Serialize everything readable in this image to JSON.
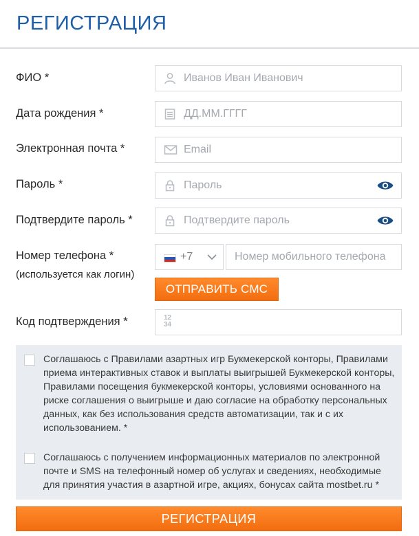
{
  "header": {
    "title": "РЕГИСТРАЦИЯ"
  },
  "form": {
    "fio": {
      "label": "ФИО *",
      "placeholder": "Иванов Иван Иванович",
      "icon": "user-icon"
    },
    "birth": {
      "label": "Дата рождения *",
      "placeholder": "ДД.ММ.ГГГГ",
      "icon": "calendar-icon"
    },
    "email": {
      "label": "Электронная почта *",
      "placeholder": "Email",
      "icon": "envelope-icon"
    },
    "password": {
      "label": "Пароль *",
      "placeholder": "Пароль",
      "icon": "lock-icon",
      "toggle_icon": "eye-icon"
    },
    "confirm": {
      "label": "Подтвердите пароль *",
      "placeholder": "Подтвердите пароль",
      "icon": "lock-icon",
      "toggle_icon": "eye-icon"
    },
    "phone": {
      "label": "Номер телефона *",
      "sublabel": "(используется как логин)",
      "country_code": "+7",
      "flag": "russia-flag-icon",
      "placeholder": "Номер мобильного телефона"
    },
    "sms_button": "ОТПРАВИТЬ СМС",
    "code": {
      "label": "Код подтверждения *",
      "icon_text_top": "12",
      "icon_text_bottom": "34"
    }
  },
  "consents": [
    {
      "checked": false,
      "text": "Соглашаюсь с Правилами азартных игр Букмекерской конторы, Правилами приема интерактивных ставок и выплаты выигрышей Букмекерской конторы, Правилами посещения букмекерской конторы, условиями основанного на риске соглашения о выигрыше и даю согласие на обработку персональных данных, как без использования средств автоматизации, так и с их использованием. *"
    },
    {
      "checked": false,
      "text": "Соглашаюсь с получением информационных материалов по электронной почте и SMS на телефонный номер об услугах и сведениях, необходимые для принятия участия в азартной игре, акциях, бонусах сайта mostbet.ru *"
    }
  ],
  "submit_button": "РЕГИСТРАЦИЯ",
  "colors": {
    "title": "#1f5ea8",
    "button": "#f26d0f",
    "eye": "#1a4f86",
    "consent_bg": "#e9ecf0"
  }
}
